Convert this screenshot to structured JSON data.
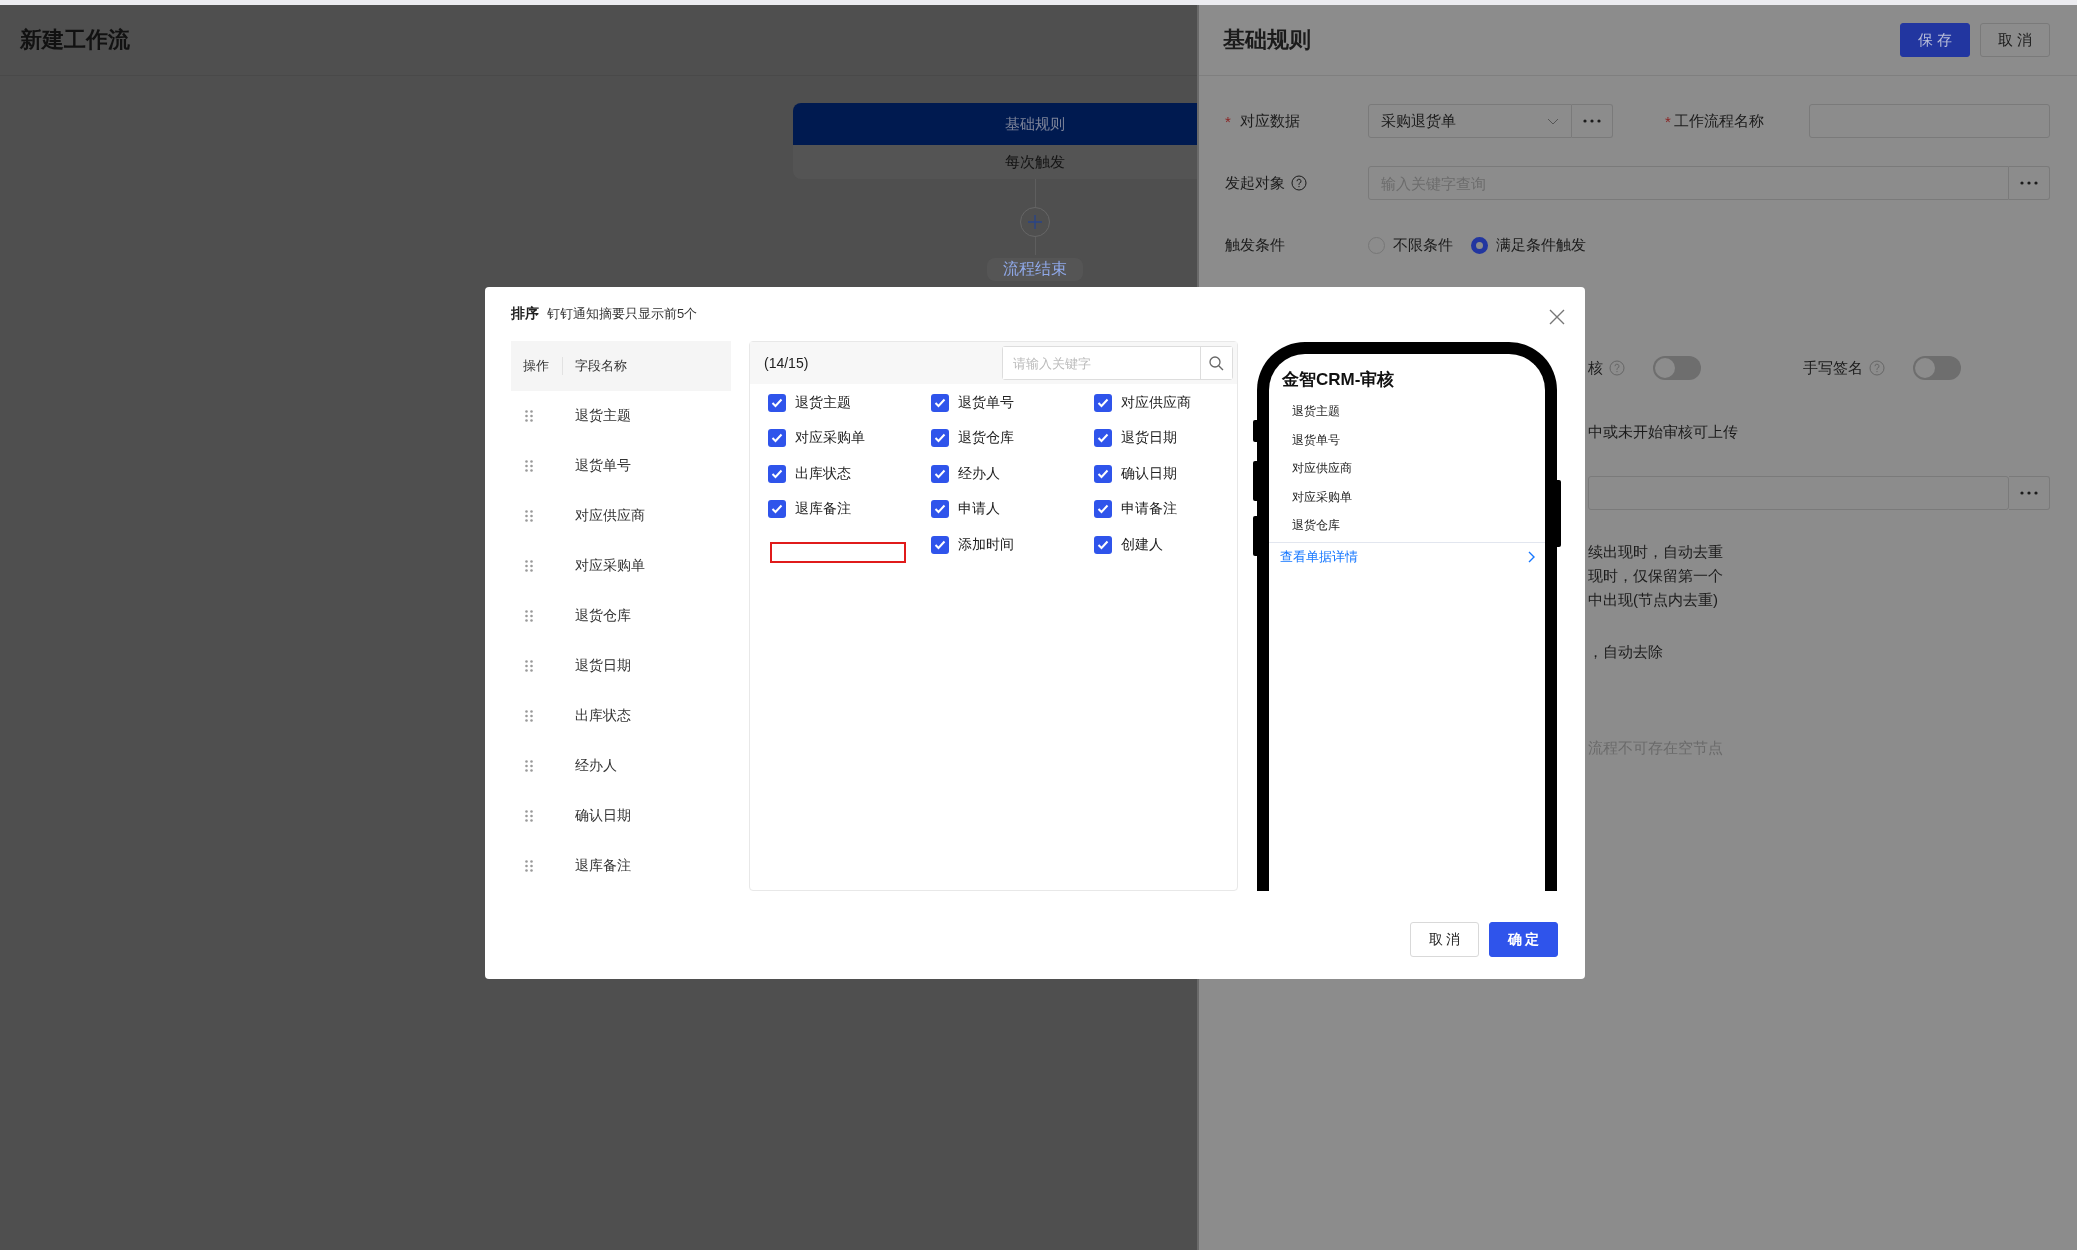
{
  "page": {
    "title": "新建工作流"
  },
  "flow": {
    "node": {
      "title": "基础规则",
      "subtitle": "每次触发"
    },
    "end_label": "流程结束"
  },
  "drawer": {
    "title": "基础规则",
    "buttons": [
      {
        "label": "保 存",
        "kind": "primary"
      },
      {
        "label": "取 消",
        "kind": "default"
      }
    ],
    "data_source": {
      "required_mark": "*",
      "label": "对应数据",
      "value": "采购退货单"
    },
    "workflow_name": {
      "required_mark": "*",
      "label": "工作流程名称"
    },
    "initiator": {
      "label": "发起对象",
      "placeholder": "输入关键字查询"
    },
    "trigger": {
      "label": "触发条件",
      "options": [
        {
          "label": "不限条件",
          "selected": false
        },
        {
          "label": "满足条件触发",
          "selected": true
        }
      ]
    },
    "switches": [
      {
        "label": "核",
        "on": false
      },
      {
        "label": "手写签名",
        "on": false
      }
    ],
    "upload_note": "中或未开始审核可上传",
    "dedupe_lines": [
      "续出现时，自动去重",
      "现时，仅保留第一个",
      "中出现(节点内去重)"
    ],
    "remove_note": "，自动去除",
    "hint": "流程不可存在空节点"
  },
  "sort_dialog": {
    "title": "排序",
    "subtitle": "钉钉通知摘要只显示前5个",
    "columns": [
      "操作",
      "字段名称"
    ],
    "rows": [
      "退货主题",
      "退货单号",
      "对应供应商",
      "对应采购单",
      "退货仓库",
      "退货日期",
      "出库状态",
      "经办人",
      "确认日期",
      "退库备注"
    ],
    "count": "(14/15)",
    "search_placeholder": "请输入关键字",
    "fields": [
      {
        "kind": "checkbox",
        "label": "退货主题",
        "checked": true
      },
      {
        "kind": "checkbox",
        "label": "退货单号",
        "checked": true
      },
      {
        "kind": "checkbox",
        "label": "对应供应商",
        "checked": true
      },
      {
        "kind": "checkbox",
        "label": "对应采购单",
        "checked": true
      },
      {
        "kind": "checkbox",
        "label": "退货仓库",
        "checked": true
      },
      {
        "kind": "checkbox",
        "label": "退货日期",
        "checked": true
      },
      {
        "kind": "checkbox",
        "label": "出库状态",
        "checked": true
      },
      {
        "kind": "checkbox",
        "label": "经办人",
        "checked": true
      },
      {
        "kind": "checkbox",
        "label": "确认日期",
        "checked": true
      },
      {
        "kind": "checkbox",
        "label": "退库备注",
        "checked": true
      },
      {
        "kind": "checkbox",
        "label": "申请人",
        "checked": true
      },
      {
        "kind": "checkbox",
        "label": "申请备注",
        "checked": true
      },
      {
        "kind": "marked-empty"
      },
      {
        "kind": "checkbox",
        "label": "添加时间",
        "checked": true
      },
      {
        "kind": "checkbox",
        "label": "创建人",
        "checked": true
      }
    ],
    "preview": {
      "title": "金智CRM-审核",
      "items": [
        "退货主题",
        "退货单号",
        "对应供应商",
        "对应采购单",
        "退货仓库"
      ],
      "link": "查看单据详情"
    },
    "buttons": [
      {
        "label": "取 消",
        "kind": "default"
      },
      {
        "label": "确 定",
        "kind": "primary"
      }
    ]
  }
}
